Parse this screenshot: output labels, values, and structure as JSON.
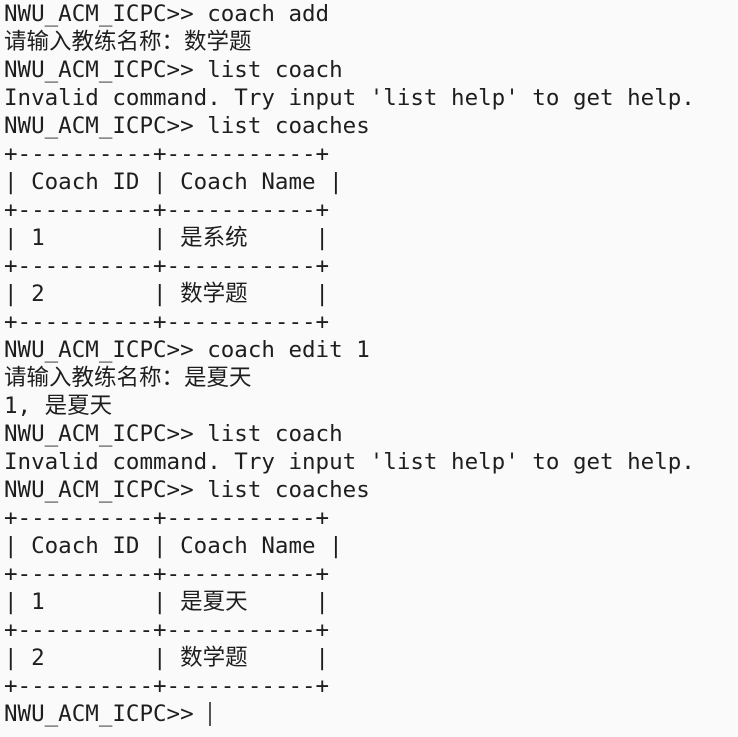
{
  "terminal": {
    "lines": [
      "NWU_ACM_ICPC>> coach add",
      "请输入教练名称：数学题",
      "NWU_ACM_ICPC>> list coach",
      "Invalid command. Try input 'list help' to get help.",
      "NWU_ACM_ICPC>> list coaches",
      "+----------+-----------+",
      "| Coach ID | Coach Name |",
      "+----------+-----------+",
      "| 1        | 是系统     |",
      "+----------+-----------+",
      "| 2        | 数学题     |",
      "+----------+-----------+",
      "NWU_ACM_ICPC>> coach edit 1",
      "请输入教练名称：是夏天",
      "1, 是夏天",
      "NWU_ACM_ICPC>> list coach",
      "Invalid command. Try input 'list help' to get help.",
      "NWU_ACM_ICPC>> list coaches",
      "+----------+-----------+",
      "| Coach ID | Coach Name |",
      "+----------+-----------+",
      "| 1        | 是夏天     |",
      "+----------+-----------+",
      "| 2        | 数学题     |",
      "+----------+-----------+"
    ],
    "prompt": "NWU_ACM_ICPC>> "
  }
}
